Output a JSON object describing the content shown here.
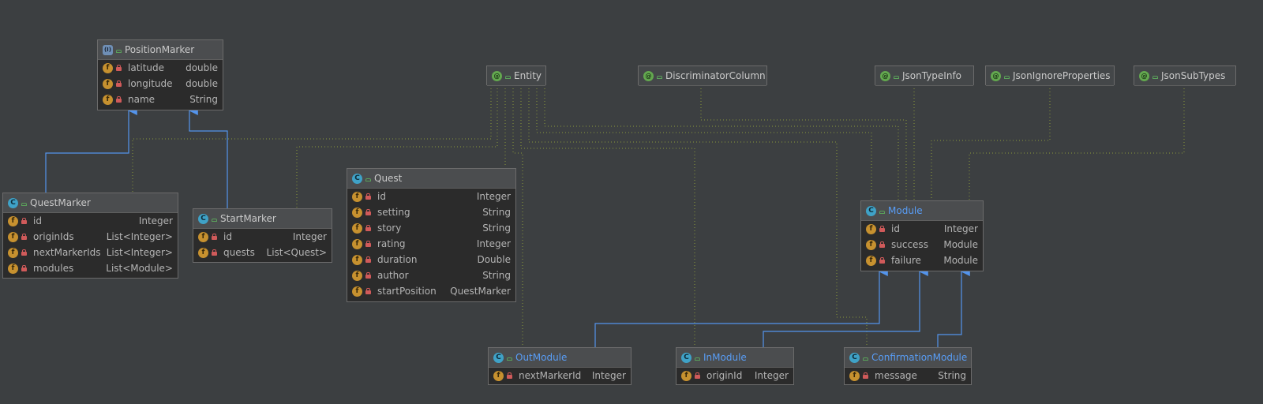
{
  "classes": {
    "position_marker": {
      "name": "PositionMarker",
      "fields": [
        {
          "name": "latitude",
          "type": "double"
        },
        {
          "name": "longitude",
          "type": "double"
        },
        {
          "name": "name",
          "type": "String"
        }
      ]
    },
    "quest_marker": {
      "name": "QuestMarker",
      "fields": [
        {
          "name": "id",
          "type": "Integer"
        },
        {
          "name": "originIds",
          "type": "List<Integer>"
        },
        {
          "name": "nextMarkerIds",
          "type": "List<Integer>"
        },
        {
          "name": "modules",
          "type": "List<Module>"
        }
      ]
    },
    "start_marker": {
      "name": "StartMarker",
      "fields": [
        {
          "name": "id",
          "type": "Integer"
        },
        {
          "name": "quests",
          "type": "List<Quest>"
        }
      ]
    },
    "quest": {
      "name": "Quest",
      "fields": [
        {
          "name": "id",
          "type": "Integer"
        },
        {
          "name": "setting",
          "type": "String"
        },
        {
          "name": "story",
          "type": "String"
        },
        {
          "name": "rating",
          "type": "Integer"
        },
        {
          "name": "duration",
          "type": "Double"
        },
        {
          "name": "author",
          "type": "String"
        },
        {
          "name": "startPosition",
          "type": "QuestMarker"
        }
      ]
    },
    "module": {
      "name": "Module",
      "fields": [
        {
          "name": "id",
          "type": "Integer"
        },
        {
          "name": "success",
          "type": "Module"
        },
        {
          "name": "failure",
          "type": "Module"
        }
      ]
    },
    "out_module": {
      "name": "OutModule",
      "fields": [
        {
          "name": "nextMarkerId",
          "type": "Integer"
        }
      ]
    },
    "in_module": {
      "name": "InModule",
      "fields": [
        {
          "name": "originId",
          "type": "Integer"
        }
      ]
    },
    "confirmation_module": {
      "name": "ConfirmationModule",
      "fields": [
        {
          "name": "message",
          "type": "String"
        }
      ]
    }
  },
  "annotations": {
    "entity": "Entity",
    "discriminator_column": "DiscriminatorColumn",
    "json_type_info": "JsonTypeInfo",
    "json_ignore_properties": "JsonIgnoreProperties",
    "json_sub_types": "JsonSubTypes"
  },
  "icons": {
    "class": "class-icon",
    "interface": "interface-icon",
    "annotation": "annotation-icon",
    "field": "field-icon",
    "public": "public-visibility-icon",
    "private": "private-visibility-icon"
  },
  "colors": {
    "background": "#3c3f41",
    "inheritance_edge": "#5394ec",
    "dependency_edge": "#8a9a3a",
    "highlight_class_name": "#589df6"
  }
}
